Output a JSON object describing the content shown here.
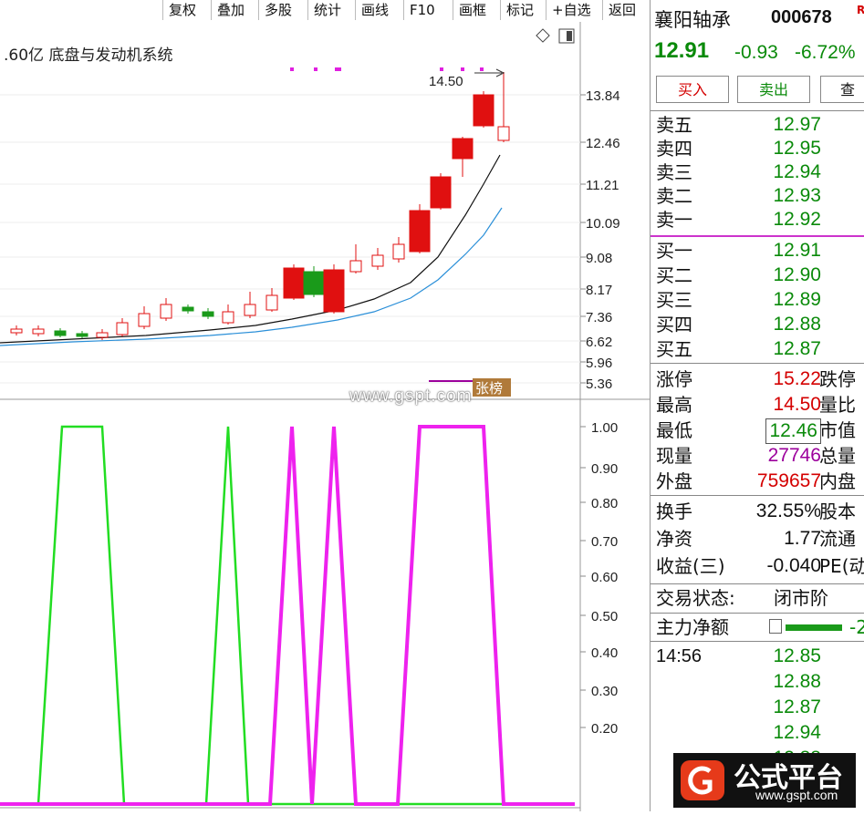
{
  "toolbar": {
    "items": [
      "复权",
      "叠加",
      "多股",
      "统计",
      "画线",
      "F10",
      "画框",
      "标记",
      "+自选",
      "返回"
    ]
  },
  "main_chart": {
    "info_text": ".60亿 底盘与发动机系统",
    "high_label": "14.50",
    "y_ticks": [
      "13.84",
      "12.46",
      "11.21",
      "10.09",
      "9.08",
      "8.17",
      "7.36",
      "6.62",
      "5.96",
      "5.36"
    ],
    "limit_badge": "张榜"
  },
  "indicator": {
    "y_ticks": [
      "1.00",
      "0.90",
      "0.80",
      "0.70",
      "0.60",
      "0.50",
      "0.40",
      "0.30",
      "0.20"
    ],
    "colors": {
      "green": "#22dd22",
      "magenta": "#ee22ee"
    }
  },
  "watermark": {
    "site": "www.gspt.com"
  },
  "quote": {
    "name": "襄阳轴承",
    "code": "000678",
    "price": "12.91",
    "change": "-0.93",
    "change_pct": "-6.72%",
    "buy_button": "买入",
    "sell_button": "卖出",
    "query_button": "查",
    "sell_orders": [
      {
        "label": "卖五",
        "price": "12.97"
      },
      {
        "label": "卖四",
        "price": "12.95"
      },
      {
        "label": "卖三",
        "price": "12.94"
      },
      {
        "label": "卖二",
        "price": "12.93"
      },
      {
        "label": "卖一",
        "price": "12.92"
      }
    ],
    "buy_orders": [
      {
        "label": "买一",
        "price": "12.91"
      },
      {
        "label": "买二",
        "price": "12.90"
      },
      {
        "label": "买三",
        "price": "12.89"
      },
      {
        "label": "买四",
        "price": "12.88"
      },
      {
        "label": "买五",
        "price": "12.87"
      }
    ],
    "stats": [
      {
        "label": "涨停",
        "value": "15.22",
        "cut": "跌停"
      },
      {
        "label": "最高",
        "value": "14.50",
        "cut": "量比"
      },
      {
        "label": "最低",
        "value": "12.46",
        "cut": "市值"
      },
      {
        "label": "现量",
        "value": "27746",
        "cut": "总量"
      },
      {
        "label": "外盘",
        "value": "759657",
        "cut": "内盘"
      }
    ],
    "fundamentals": [
      {
        "label": "换手",
        "value": "32.55%",
        "cut": "股本"
      },
      {
        "label": "净资",
        "value": "1.77",
        "cut": "流通"
      },
      {
        "label": "收益(三)",
        "value": "-0.040",
        "cut": "PE(动"
      }
    ],
    "trade_status_label": "交易状态:",
    "trade_status_value": "闭市阶",
    "main_net_label": "主力净额",
    "main_net_value": "-2",
    "ticks": [
      {
        "time": "14:56",
        "price": "12.85"
      },
      {
        "time": "",
        "price": "12.88"
      },
      {
        "time": "",
        "price": "12.87"
      },
      {
        "time": "",
        "price": "12.94"
      },
      {
        "time": "",
        "price": "12.88"
      }
    ]
  },
  "brand": {
    "name": "公式平台",
    "url": "www.gspt.com"
  }
}
